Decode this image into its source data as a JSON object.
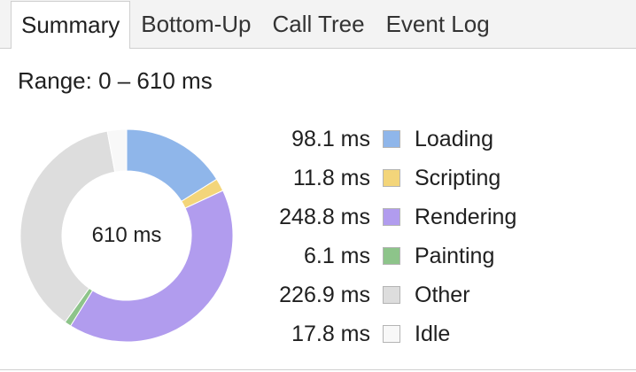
{
  "tabs": [
    {
      "label": "Summary",
      "selected": true
    },
    {
      "label": "Bottom-Up",
      "selected": false
    },
    {
      "label": "Call Tree",
      "selected": false
    },
    {
      "label": "Event Log",
      "selected": false
    }
  ],
  "range_text": "Range: 0 – 610 ms",
  "chart_data": {
    "type": "pie",
    "center_label": "610 ms",
    "categories": [
      "Loading",
      "Scripting",
      "Rendering",
      "Painting",
      "Other",
      "Idle"
    ],
    "values": [
      98.1,
      11.8,
      248.8,
      6.1,
      226.9,
      17.8
    ],
    "value_labels": [
      "98.1 ms",
      "11.8 ms",
      "248.8 ms",
      "6.1 ms",
      "226.9 ms",
      "17.8 ms"
    ],
    "colors": [
      "#8fb6ea",
      "#f3d57a",
      "#b19cee",
      "#8dc48a",
      "#dddddd",
      "#f8f8f8"
    ],
    "legend_placement": "right"
  }
}
